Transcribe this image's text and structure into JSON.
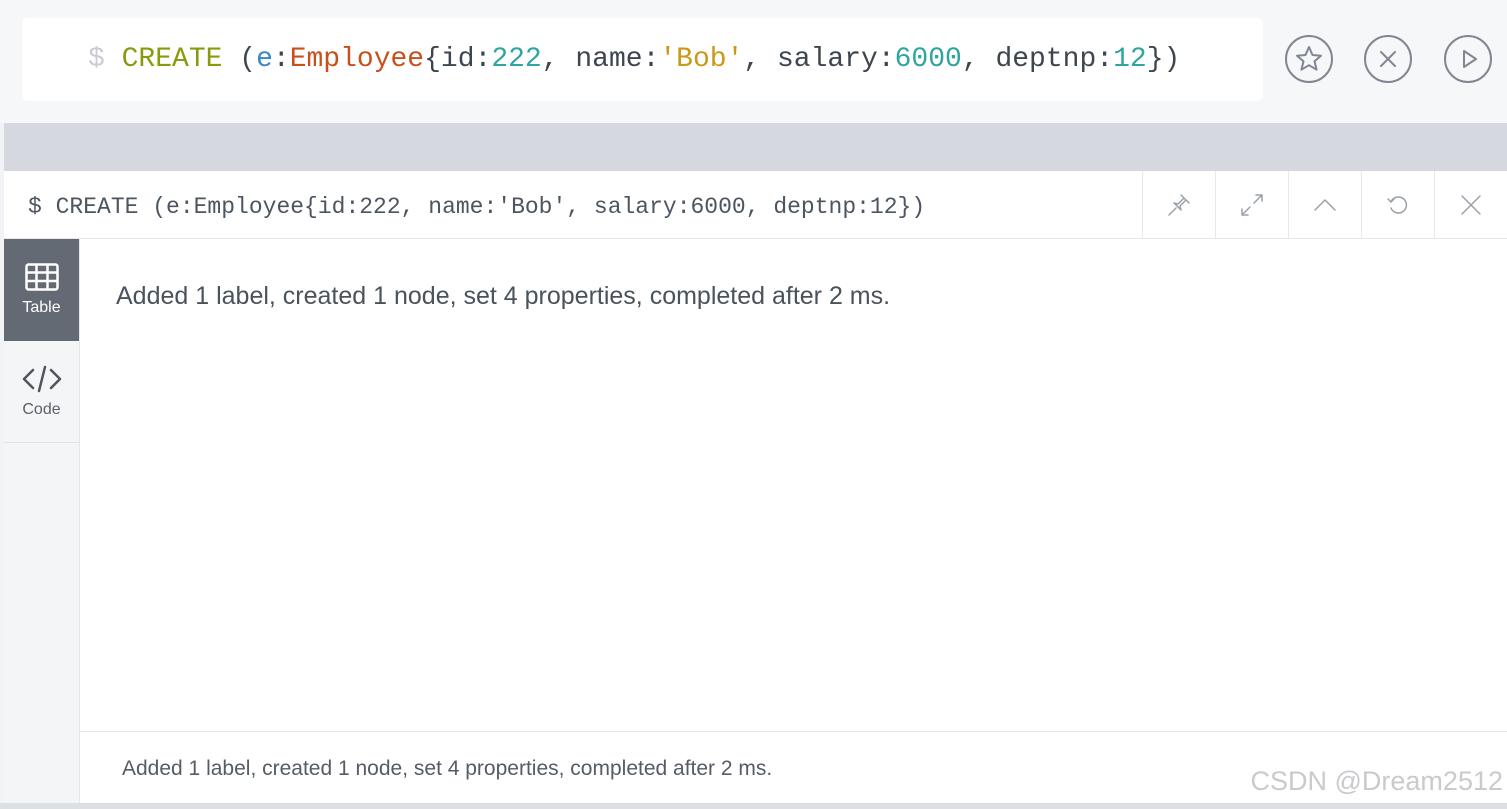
{
  "editor": {
    "prompt": "$",
    "tokens": [
      {
        "text": "CREATE",
        "kind": "keyword"
      },
      {
        "text": " (",
        "kind": "punct"
      },
      {
        "text": "e",
        "kind": "var"
      },
      {
        "text": ":",
        "kind": "punct"
      },
      {
        "text": "Employee",
        "kind": "label"
      },
      {
        "text": "{id:",
        "kind": "punct"
      },
      {
        "text": "222",
        "kind": "num"
      },
      {
        "text": ", name:",
        "kind": "punct"
      },
      {
        "text": "'Bob'",
        "kind": "str"
      },
      {
        "text": ", salary:",
        "kind": "punct"
      },
      {
        "text": "6000",
        "kind": "num"
      },
      {
        "text": ", deptnp:",
        "kind": "punct"
      },
      {
        "text": "12",
        "kind": "num"
      },
      {
        "text": "})",
        "kind": "punct"
      }
    ],
    "buttons": {
      "favorite_icon": "star-icon",
      "clear_icon": "close-icon",
      "run_icon": "play-icon"
    }
  },
  "frame": {
    "title": "$ CREATE (e:Employee{id:222, name:'Bob', salary:6000, deptnp:12})",
    "actions": [
      {
        "name": "pin",
        "icon": "pin-icon"
      },
      {
        "name": "fullscreen",
        "icon": "expand-icon"
      },
      {
        "name": "collapse",
        "icon": "chevron-up-icon"
      },
      {
        "name": "rerun",
        "icon": "refresh-icon"
      },
      {
        "name": "close",
        "icon": "close-icon"
      }
    ],
    "tabs": {
      "table": {
        "label": "Table",
        "icon": "table-icon",
        "active": true
      },
      "code": {
        "label": "Code",
        "icon": "code-icon",
        "active": false
      }
    },
    "result_message": "Added 1 label, created 1 node, set 4 properties, completed after 2 ms.",
    "status_message": "Added 1 label, created 1 node, set 4 properties, completed after 2 ms."
  },
  "watermark": "CSDN @Dream2512",
  "colors": {
    "keyword": "#8a9a0c",
    "var": "#3a87c9",
    "label": "#c8501d",
    "number": "#2fa5a0",
    "string": "#c79a1a",
    "active_tab": "#646a73"
  }
}
